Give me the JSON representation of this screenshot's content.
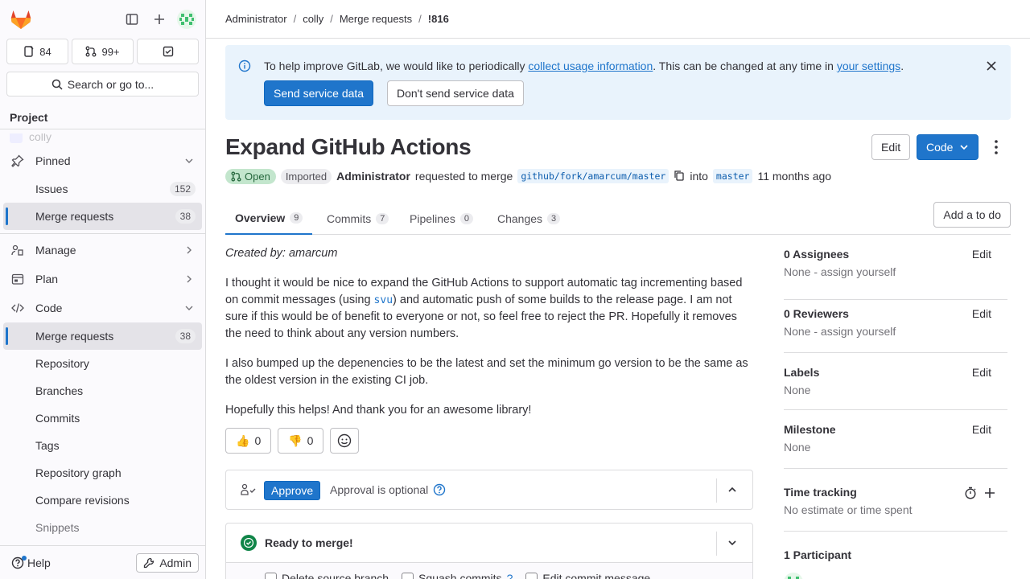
{
  "sidebar": {
    "counters": [
      {
        "icon": "issues-icon",
        "value": "84"
      },
      {
        "icon": "merge-request-icon",
        "value": "99+"
      },
      {
        "icon": "todo-icon",
        "value": ""
      }
    ],
    "search_label": "Search or go to...",
    "section_title": "Project",
    "ghost_project": "colly",
    "items": {
      "pinned": "Pinned",
      "issues": {
        "label": "Issues",
        "count": "152"
      },
      "merge_requests_pinned": {
        "label": "Merge requests",
        "count": "38"
      },
      "manage": "Manage",
      "plan": "Plan",
      "code": "Code",
      "merge_requests": {
        "label": "Merge requests",
        "count": "38"
      },
      "repository": "Repository",
      "branches": "Branches",
      "commits": "Commits",
      "tags": "Tags",
      "repository_graph": "Repository graph",
      "compare_revisions": "Compare revisions",
      "snippets": "Snippets"
    },
    "help": "Help",
    "admin": "Admin"
  },
  "breadcrumb": [
    "Administrator",
    "colly",
    "Merge requests",
    "!816"
  ],
  "banner": {
    "text_before": "To help improve GitLab, we would like to periodically ",
    "link1": "collect usage information",
    "text_middle": ". This can be changed at any time in ",
    "link2": "your settings",
    "text_after": ".",
    "send_button": "Send service data",
    "dont_send_button": "Don't send service data"
  },
  "mr": {
    "title": "Expand GitHub Actions",
    "edit_button": "Edit",
    "code_button": "Code",
    "status": "Open",
    "imported": "Imported",
    "author": "Administrator",
    "requested_text": "requested to merge",
    "source_branch": "github/fork/amarcum/master",
    "into_text": "into",
    "target_branch": "master",
    "time": "11 months ago"
  },
  "tabs": [
    {
      "label": "Overview",
      "count": "9"
    },
    {
      "label": "Commits",
      "count": "7"
    },
    {
      "label": "Pipelines",
      "count": "0"
    },
    {
      "label": "Changes",
      "count": "3"
    }
  ],
  "add_todo": "Add a to do",
  "description": {
    "created_by": "Created by: amarcum",
    "p1_before": "I thought it would be nice to expand the GitHub Actions to support automatic tag incrementing based on commit messages (using ",
    "p1_code": "svu",
    "p1_after": ") and automatic push of some builds to the release page. I am not sure if this would be of benefit to everyone or not, so feel free to reject the PR. Hopefully it removes the need to think about any version numbers.",
    "p2": "I also bumped up the depenencies to be the latest and set the minimum go version to be the same as the oldest version in the existing CI job.",
    "p3": "Hopefully this helps! And thank you for an awesome library!"
  },
  "reactions": {
    "thumbs_up": "👍",
    "thumbs_up_count": "0",
    "thumbs_down": "👎",
    "thumbs_down_count": "0"
  },
  "approval": {
    "button": "Approve",
    "text": "Approval is optional"
  },
  "merge": {
    "ready": "Ready to merge!",
    "opts": [
      "Delete source branch",
      "Squash commits",
      "Edit commit message"
    ]
  },
  "right_sidebar": {
    "assignees": {
      "title": "0 Assignees",
      "value": "None - assign yourself",
      "edit": "Edit"
    },
    "reviewers": {
      "title": "0 Reviewers",
      "value": "None - assign yourself",
      "edit": "Edit"
    },
    "labels": {
      "title": "Labels",
      "value": "None",
      "edit": "Edit"
    },
    "milestone": {
      "title": "Milestone",
      "value": "None",
      "edit": "Edit"
    },
    "time_tracking": {
      "title": "Time tracking",
      "value": "No estimate or time spent"
    },
    "participants": {
      "title": "1 Participant"
    }
  },
  "colors": {
    "accent": "#1f75cb",
    "open_bg": "#c3e6cd",
    "success": "#108548",
    "brand": "#e24329"
  }
}
